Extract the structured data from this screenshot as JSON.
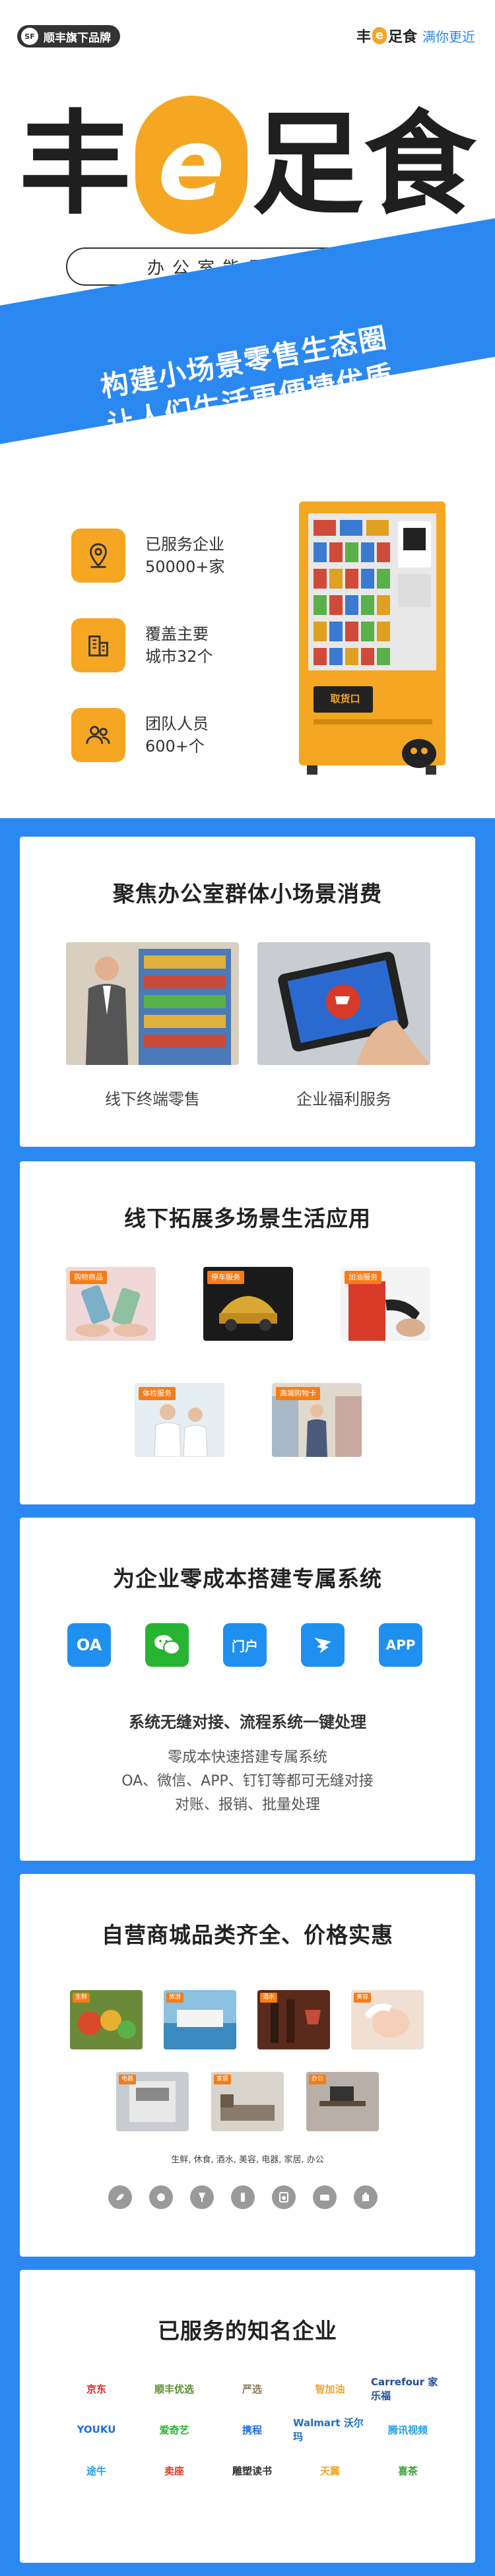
{
  "header": {
    "sf_mark": "SF",
    "sf_badge": "顺丰旗下品牌",
    "brand_left": "丰",
    "brand_e": "e",
    "brand_right": "足食",
    "brand_slogan": "满你更近"
  },
  "hero": {
    "logo_chars": [
      "丰",
      "e",
      "足",
      "食"
    ],
    "subtitle": "办公室能量补给站",
    "banner_line1": "构建小场景零售生态圈",
    "banner_line2": "让人们生活更便捷优质",
    "stats": [
      {
        "icon": "location-pin-icon",
        "line1": "已服务企业",
        "line2": "50000+家"
      },
      {
        "icon": "buildings-icon",
        "line1": "覆盖主要",
        "line2": "城市32个"
      },
      {
        "icon": "team-icon",
        "line1": "团队人员",
        "line2": "600+个"
      }
    ],
    "vending_label": "取货口"
  },
  "section1": {
    "title": "聚焦办公室群体小场景消费",
    "items": [
      {
        "caption": "线下终端零售"
      },
      {
        "caption": "企业福利服务"
      }
    ]
  },
  "section2": {
    "title": "线下拓展多场景生活应用",
    "items": [
      {
        "tag": "购物商品"
      },
      {
        "tag": "停车服务"
      },
      {
        "tag": "加油服务"
      },
      {
        "tag": "体检服务"
      },
      {
        "tag": "高端购物卡"
      }
    ]
  },
  "section3": {
    "title": "为企业零成本搭建专属系统",
    "icons": [
      {
        "label": "OA",
        "color": "#1f8ff0"
      },
      {
        "label": "",
        "color": "#27b432"
      },
      {
        "label": "门户",
        "color": "#1f8ff0"
      },
      {
        "label": "",
        "color": "#1f8ff0"
      },
      {
        "label": "APP",
        "color": "#1f8ff0"
      }
    ],
    "subtitle": "系统无缝对接、流程系统一键处理",
    "desc1": "零成本快速搭建专属系统",
    "desc2": "OA、微信、APP、钉钉等都可无缝对接",
    "desc3": "对账、报销、批量处理"
  },
  "section4": {
    "title": "自营商城品类齐全、价格实惠",
    "items": [
      {
        "tag": "生鲜"
      },
      {
        "tag": "旅游"
      },
      {
        "tag": "酒水"
      },
      {
        "tag": "美容"
      },
      {
        "tag": "电器"
      },
      {
        "tag": "家居"
      },
      {
        "tag": "办公"
      }
    ],
    "categories": "生鲜, 休食, 酒水, 美容, 电器, 家居, 办公"
  },
  "section5": {
    "title": "已服务的知名企业",
    "logos": [
      {
        "text": "京东",
        "color": "#e1251b"
      },
      {
        "text": "顺丰优选",
        "color": "#5a8d2e"
      },
      {
        "text": "严选",
        "color": "#8a7a5a"
      },
      {
        "text": "智加油",
        "color": "#f5a623"
      },
      {
        "text": "Carrefour 家乐福",
        "color": "#1d4e9e"
      },
      {
        "text": "YOUKU",
        "color": "#1f6fe0"
      },
      {
        "text": "爱奇艺",
        "color": "#27b432"
      },
      {
        "text": "携程",
        "color": "#1f6fe0"
      },
      {
        "text": "Walmart 沃尔玛",
        "color": "#1d70c4"
      },
      {
        "text": "腾讯视频",
        "color": "#1fa0e8"
      },
      {
        "text": "途牛",
        "color": "#1fa0e8"
      },
      {
        "text": "卖座",
        "color": "#d83a2a"
      },
      {
        "text": "雕塑读书",
        "color": "#333333"
      },
      {
        "text": "天翼",
        "color": "#f5a623"
      },
      {
        "text": "喜茶",
        "color": "#3a9e3a"
      }
    ]
  }
}
